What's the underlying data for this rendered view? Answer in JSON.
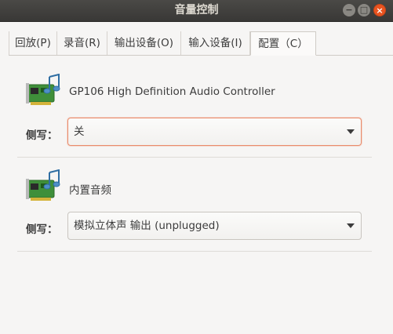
{
  "window": {
    "title": "音量控制",
    "controls": {
      "minimize": "−",
      "maximize": "□",
      "close": "×"
    }
  },
  "tabs": [
    {
      "label": "回放(P)",
      "active": false
    },
    {
      "label": "录音(R)",
      "active": false
    },
    {
      "label": "输出设备(O)",
      "active": false
    },
    {
      "label": "输入设备(I)",
      "active": false
    },
    {
      "label": "配置（C）",
      "active": true
    }
  ],
  "devices": [
    {
      "name": "GP106 High Definition Audio Controller",
      "profile_label": "侧写：",
      "profile_value": "关",
      "icon": "sound-card-icon"
    },
    {
      "name": "内置音频",
      "profile_label": "侧写：",
      "profile_value": "模拟立体声 输出 (unplugged)",
      "icon": "sound-card-icon"
    }
  ],
  "colors": {
    "accent": "#e95420",
    "titlebar": "#3c3b37",
    "background": "#f6f5f4"
  }
}
